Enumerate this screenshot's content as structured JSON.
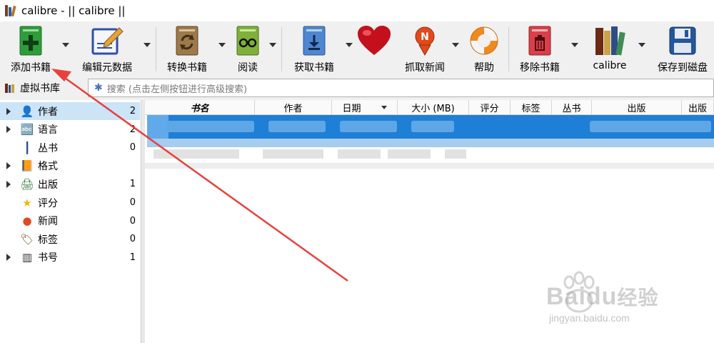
{
  "window": {
    "title": "calibre - || calibre ||"
  },
  "toolbar": {
    "add_books": "添加书籍",
    "edit_metadata": "编辑元数据",
    "convert_books": "转换书籍",
    "read": "阅读",
    "get_books": "获取书籍",
    "fetch_news": "抓取新闻",
    "help": "帮助",
    "remove_books": "移除书籍",
    "calibre": "calibre",
    "save_to_disk": "保存到磁盘"
  },
  "virtual_library": {
    "label": "虚拟书库"
  },
  "search": {
    "placeholder": "搜索 (点击左侧按钮进行高级搜索)"
  },
  "tag_browser": {
    "items": [
      {
        "name": "作者",
        "count": "2",
        "icon": "person-icon",
        "expandable": true,
        "selected": true
      },
      {
        "name": "语言",
        "count": "2",
        "icon": "language-icon",
        "expandable": true,
        "selected": false
      },
      {
        "name": "丛书",
        "count": "0",
        "icon": "series-icon",
        "expandable": false,
        "selected": false
      },
      {
        "name": "格式",
        "count": "",
        "icon": "book-format-icon",
        "expandable": true,
        "selected": false
      },
      {
        "name": "出版",
        "count": "1",
        "icon": "publisher-icon",
        "expandable": true,
        "selected": false
      },
      {
        "name": "评分",
        "count": "0",
        "icon": "star-icon",
        "expandable": false,
        "selected": false
      },
      {
        "name": "新闻",
        "count": "0",
        "icon": "news-icon",
        "expandable": false,
        "selected": false
      },
      {
        "name": "标签",
        "count": "0",
        "icon": "tag-icon",
        "expandable": false,
        "selected": false
      },
      {
        "name": "书号",
        "count": "1",
        "icon": "barcode-icon",
        "expandable": true,
        "selected": false
      }
    ]
  },
  "book_list": {
    "columns": [
      "书名",
      "作者",
      "日期",
      "大小 (MB)",
      "评分",
      "标签",
      "丛书",
      "出版",
      "出版"
    ],
    "sorted_column": "日期"
  },
  "watermark": {
    "brand": "Baidu",
    "brand_cn": "经验",
    "url": "jingyan.baidu.com"
  },
  "colors": {
    "accent": "#1e7fd6",
    "annotation": "#e8413c",
    "selected_tag": "#cce4f7"
  }
}
